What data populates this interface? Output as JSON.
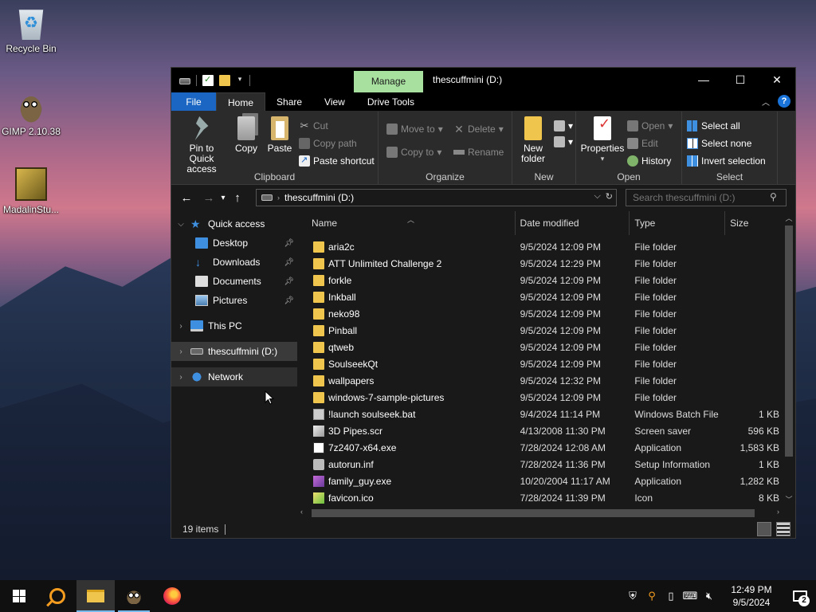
{
  "desktop": {
    "icons": [
      {
        "label": "Recycle Bin",
        "icon": "recycle-bin-icon"
      },
      {
        "label": "GIMP 2.10.38",
        "icon": "gimp-icon"
      },
      {
        "label": "MadalinStu...",
        "icon": "madalin-app-icon"
      }
    ]
  },
  "window": {
    "title": "thescuffmini (D:)",
    "manage_tab": "Manage",
    "tabs": [
      "File",
      "Home",
      "Share",
      "View",
      "Drive Tools"
    ],
    "active_tab": "Home",
    "controls": {
      "minimize": "—",
      "maximize": "☐",
      "close": "✕"
    },
    "help_label": "?"
  },
  "ribbon": {
    "clipboard": {
      "label": "Clipboard",
      "pin": "Pin to Quick access",
      "copy": "Copy",
      "paste": "Paste",
      "cut": "Cut",
      "copy_path": "Copy path",
      "paste_shortcut": "Paste shortcut"
    },
    "organize": {
      "label": "Organize",
      "move_to": "Move to",
      "copy_to": "Copy to",
      "delete": "Delete",
      "rename": "Rename"
    },
    "new": {
      "label": "New",
      "new_folder": "New folder"
    },
    "open": {
      "label": "Open",
      "properties": "Properties",
      "open": "Open",
      "edit": "Edit",
      "history": "History"
    },
    "select": {
      "label": "Select",
      "select_all": "Select all",
      "select_none": "Select none",
      "invert": "Invert selection"
    }
  },
  "address": {
    "path": "thescuffmini (D:)",
    "search_placeholder": "Search thescuffmini (D:)"
  },
  "nav": {
    "quick_access": "Quick access",
    "pinned": [
      "Desktop",
      "Downloads",
      "Documents",
      "Pictures"
    ],
    "this_pc": "This PC",
    "drive": "thescuffmini (D:)",
    "network": "Network"
  },
  "columns": {
    "name": "Name",
    "date": "Date modified",
    "type": "Type",
    "size": "Size"
  },
  "files": [
    {
      "name": "aria2c",
      "date": "9/5/2024 12:09 PM",
      "type": "File folder",
      "size": "",
      "icon": "folder"
    },
    {
      "name": "ATT Unlimited Challenge 2",
      "date": "9/5/2024 12:29 PM",
      "type": "File folder",
      "size": "",
      "icon": "folder"
    },
    {
      "name": "forkle",
      "date": "9/5/2024 12:09 PM",
      "type": "File folder",
      "size": "",
      "icon": "folder"
    },
    {
      "name": "Inkball",
      "date": "9/5/2024 12:09 PM",
      "type": "File folder",
      "size": "",
      "icon": "folder"
    },
    {
      "name": "neko98",
      "date": "9/5/2024 12:09 PM",
      "type": "File folder",
      "size": "",
      "icon": "folder"
    },
    {
      "name": "Pinball",
      "date": "9/5/2024 12:09 PM",
      "type": "File folder",
      "size": "",
      "icon": "folder"
    },
    {
      "name": "qtweb",
      "date": "9/5/2024 12:09 PM",
      "type": "File folder",
      "size": "",
      "icon": "folder"
    },
    {
      "name": "SoulseekQt",
      "date": "9/5/2024 12:09 PM",
      "type": "File folder",
      "size": "",
      "icon": "folder"
    },
    {
      "name": "wallpapers",
      "date": "9/5/2024 12:32 PM",
      "type": "File folder",
      "size": "",
      "icon": "folder"
    },
    {
      "name": "windows-7-sample-pictures",
      "date": "9/5/2024 12:09 PM",
      "type": "File folder",
      "size": "",
      "icon": "folder"
    },
    {
      "name": "!launch soulseek.bat",
      "date": "9/4/2024 11:14 PM",
      "type": "Windows Batch File",
      "size": "1 KB",
      "icon": "bat"
    },
    {
      "name": "3D Pipes.scr",
      "date": "4/13/2008 11:30 PM",
      "type": "Screen saver",
      "size": "596 KB",
      "icon": "scr"
    },
    {
      "name": "7z2407-x64.exe",
      "date": "7/28/2024 12:08 AM",
      "type": "Application",
      "size": "1,583 KB",
      "icon": "exe7z"
    },
    {
      "name": "autorun.inf",
      "date": "7/28/2024 11:36 PM",
      "type": "Setup Information",
      "size": "1 KB",
      "icon": "inf"
    },
    {
      "name": "family_guy.exe",
      "date": "10/20/2004 11:17 AM",
      "type": "Application",
      "size": "1,282 KB",
      "icon": "fg"
    },
    {
      "name": "favicon.ico",
      "date": "7/28/2024 11:39 PM",
      "type": "Icon",
      "size": "8 KB",
      "icon": "ico"
    }
  ],
  "status": {
    "items": "19 items"
  },
  "taskbar": {
    "time": "12:49 PM",
    "date": "9/5/2024",
    "notifications": "2"
  }
}
